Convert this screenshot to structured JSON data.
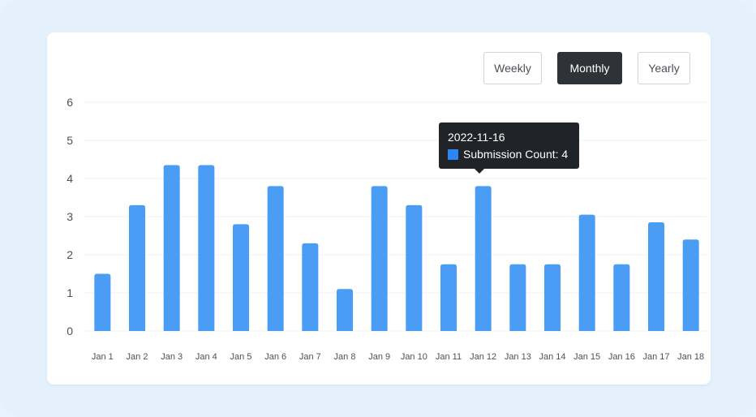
{
  "period_toggle": {
    "buttons": [
      "Weekly",
      "Monthly",
      "Yearly"
    ],
    "selected": "Monthly"
  },
  "tooltip": {
    "date": "2022-11-16",
    "series_label": "Submission Count: 4",
    "swatch_color": "#2b87f3"
  },
  "colors": {
    "bar": "#4a9cf5",
    "active_button": "#2f3236",
    "grid": "#eef0f3"
  },
  "chart_data": {
    "type": "bar",
    "categories": [
      "Jan 1",
      "Jan 2",
      "Jan 3",
      "Jan 4",
      "Jan 5",
      "Jan 6",
      "Jan 7",
      "Jan 8",
      "Jan 9",
      "Jan 10",
      "Jan 11",
      "Jan 12",
      "Jan 13",
      "Jan 14",
      "Jan 15",
      "Jan 16",
      "Jan 17",
      "Jan 18"
    ],
    "values": [
      1.5,
      3.3,
      4.35,
      4.35,
      2.8,
      3.8,
      2.3,
      1.1,
      3.8,
      3.3,
      1.75,
      3.8,
      1.75,
      1.75,
      3.05,
      1.75,
      2.85,
      2.4
    ],
    "ylim": [
      0,
      6
    ],
    "yticks": [
      0,
      1,
      2,
      3,
      4,
      5,
      6
    ],
    "grid": true
  }
}
